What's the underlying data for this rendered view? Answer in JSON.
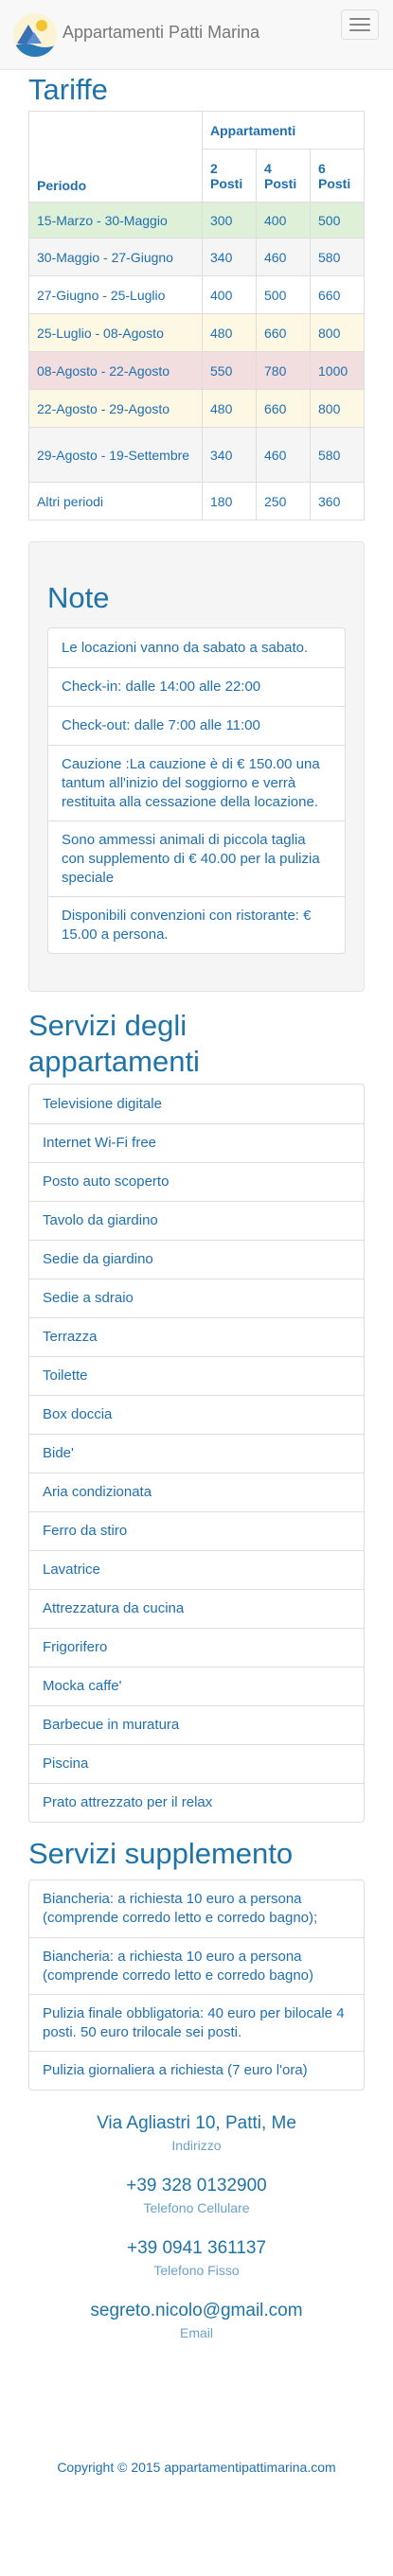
{
  "brand": {
    "title": "Appartamenti Patti Marina"
  },
  "rates": {
    "heading": "Tariffe",
    "group_header": "Appartamenti",
    "period_header": "Periodo",
    "columns": [
      "2 Posti",
      "4 Posti",
      "6 Posti"
    ],
    "rows": [
      {
        "period": "15-Marzo - 30-Maggio",
        "values": [
          "300",
          "400",
          "500"
        ],
        "style": "success"
      },
      {
        "period": "30-Maggio - 27-Giugno",
        "values": [
          "340",
          "460",
          "580"
        ],
        "style": "active"
      },
      {
        "period": "27-Giugno - 25-Luglio",
        "values": [
          "400",
          "500",
          "660"
        ],
        "style": "none"
      },
      {
        "period": "25-Luglio - 08-Agosto",
        "values": [
          "480",
          "660",
          "800"
        ],
        "style": "warning"
      },
      {
        "period": "08-Agosto - 22-Agosto",
        "values": [
          "550",
          "780",
          "1000"
        ],
        "style": "danger"
      },
      {
        "period": "22-Agosto - 29-Agosto",
        "values": [
          "480",
          "660",
          "800"
        ],
        "style": "warning"
      },
      {
        "period": "29-Agosto - 19-Settembre",
        "values": [
          "340",
          "460",
          "580"
        ],
        "style": "active"
      },
      {
        "period": "Altri periodi",
        "values": [
          "180",
          "250",
          "360"
        ],
        "style": "none"
      }
    ]
  },
  "notes": {
    "heading": "Note",
    "items": [
      "Le locazioni vanno da sabato a sabato.",
      "Check-in: dalle 14:00 alle 22:00",
      "Check-out: dalle 7:00 alle 11:00",
      "Cauzione :La cauzione è di € 150.00 una tantum all'inizio del soggiorno e verrà restituita alla cessazione della locazione.",
      "Sono ammessi animali di piccola taglia con supplemento di € 40.00 per la pulizia speciale",
      "Disponibili convenzioni con ristorante: € 15.00 a persona."
    ]
  },
  "services": {
    "heading": "Servizi degli appartamenti",
    "items": [
      "Televisione digitale",
      "Internet Wi-Fi free",
      "Posto auto scoperto",
      "Tavolo da giardino",
      "Sedie da giardino",
      "Sedie a sdraio",
      "Terrazza",
      "Toilette",
      "Box doccia",
      "Bide'",
      "Aria condizionata",
      "Ferro da stiro",
      "Lavatrice",
      "Attrezzatura da cucina",
      "Frigorifero",
      "Mocka caffe'",
      "Barbecue in muratura",
      "Piscina",
      "Prato attrezzato per il relax"
    ]
  },
  "supplements": {
    "heading": "Servizi supplemento",
    "items": [
      "Biancheria: a richiesta 10 euro a persona (comprende corredo letto e corredo bagno);",
      "Biancheria: a richiesta 10 euro a persona (comprende corredo letto e corredo bagno)",
      "Pulizia finale obbligatoria: 40 euro per bilocale 4 posti. 50 euro trilocale sei posti.",
      "Pulizia giornaliera a richiesta (7 euro l'ora)"
    ]
  },
  "contacts": [
    {
      "value": "Via Agliastri 10, Patti, Me",
      "label": "Indirizzo"
    },
    {
      "value": "+39 328 0132900",
      "label": "Telefono Cellulare"
    },
    {
      "value": "+39 0941 361137",
      "label": "Telefono Fisso"
    },
    {
      "value": "segreto.nicolo@gmail.com",
      "label": "Email"
    }
  ],
  "footer": {
    "copyright": "Copyright © 2015 appartamentipattimarina.com"
  },
  "colors": {
    "accent": "#1e73a8",
    "success": "#dff0d8",
    "warning": "#fcf8e3",
    "danger": "#f2dede",
    "active": "#f5f5f5"
  }
}
